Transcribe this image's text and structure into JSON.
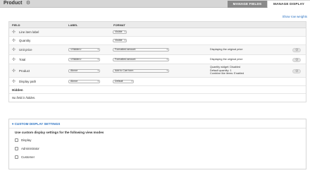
{
  "header": {
    "title": "Product",
    "tabs": [
      {
        "label": "MANAGE FIELDS",
        "active": false
      },
      {
        "label": "MANAGE DISPLAY",
        "active": true
      }
    ]
  },
  "show_row_weights": "Show row weights",
  "table": {
    "columns": [
      "FIELD",
      "LABEL",
      "FORMAT"
    ],
    "rows": [
      {
        "field": "Line item label",
        "label": "",
        "format": "Visible",
        "summary": []
      },
      {
        "field": "Quantity",
        "label": "",
        "format": "Visible",
        "summary": []
      },
      {
        "field": "Unit price",
        "label": "<Hidden>",
        "format": "Formatted amount",
        "summary": [
          "Displaying the original price"
        ]
      },
      {
        "field": "Total",
        "label": "<Hidden>",
        "format": "Formatted amount",
        "summary": [
          "Displaying the original price"
        ]
      },
      {
        "field": "Product",
        "label": "Above",
        "format": "Add to Cart form",
        "summary": [
          "Quantity widget: Disabled",
          "Default quantity: 1",
          "Combine like items: Enabled"
        ]
      },
      {
        "field": "Display path",
        "label": "Above",
        "format": "Default",
        "summary": []
      }
    ],
    "hidden_title": "Hidden",
    "hidden_empty": "No field is hidden."
  },
  "custom_display": {
    "legend": "CUSTOM DISPLAY SETTINGS",
    "description": "Use custom display settings for the following view modes",
    "options": [
      {
        "label": "Display",
        "checked": false
      },
      {
        "label": "Administrator",
        "checked": false
      },
      {
        "label": "Customer",
        "checked": false
      }
    ]
  },
  "colors": {
    "link": "#2b72c2",
    "header_bg": "#d6d6d6",
    "inactive_tab": "#8a8a8a"
  }
}
